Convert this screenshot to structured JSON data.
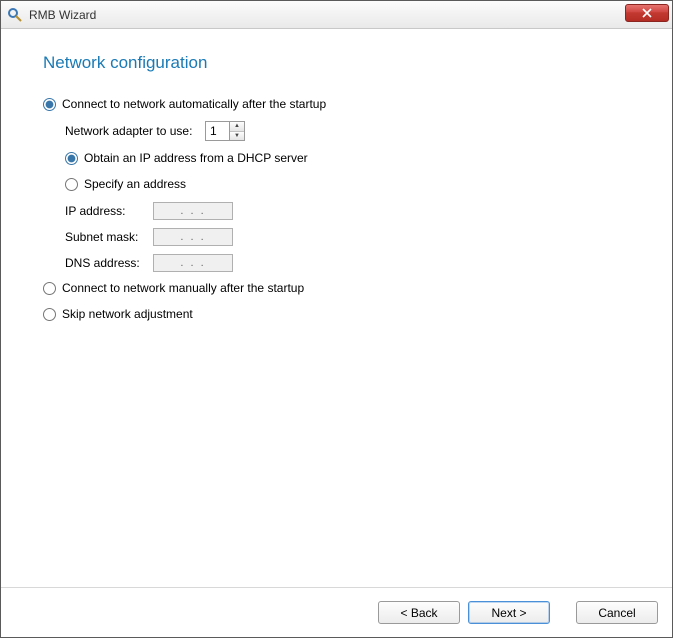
{
  "window": {
    "title": "RMB Wizard"
  },
  "heading": "Network configuration",
  "options": {
    "auto": "Connect to network automatically after the startup",
    "manual": "Connect to network manually after the startup",
    "skip": "Skip network adjustment",
    "selected": "auto"
  },
  "adapter": {
    "label": "Network adapter to use:",
    "value": "1"
  },
  "ip_mode": {
    "dhcp": "Obtain an IP address from a DHCP server",
    "specify": "Specify an address",
    "selected": "dhcp"
  },
  "fields": {
    "ip_label": "IP address:",
    "subnet_label": "Subnet mask:",
    "dns_label": "DNS address:",
    "placeholder": ".     .     ."
  },
  "buttons": {
    "back": "< Back",
    "next": "Next >",
    "cancel": "Cancel"
  }
}
